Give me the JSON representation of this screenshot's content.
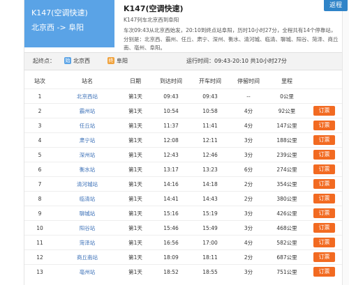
{
  "header": {
    "train_code": "K147(空调快速)",
    "route": "北京西 -> 阜阳",
    "title": "K147(空调快速)",
    "subtitle": "K147列车北京西到阜阳",
    "description": "车次09:43从北京西始发，20:10到终点站阜阳，历时10小时27分，全程共有14个停靠站，分别是：北京西、霸州、任丘、肃宁、深州、衡水、清河城、临清、聊城、阳谷、菏泽、商丘南、亳州、阜阳。",
    "back_label": "返程"
  },
  "info_bar": {
    "label": "起终点：",
    "start": "北京西",
    "start_icon": "始",
    "end": "阜阳",
    "end_icon": "终",
    "run_info": "运行时间：09:43-20:10 共10小时27分"
  },
  "table": {
    "headers": [
      "站次",
      "站名",
      "日期",
      "到达时间",
      "开车时间",
      "停留时间",
      "里程",
      ""
    ],
    "book_label": "订票",
    "rows": [
      {
        "no": "1",
        "station": "北京西站",
        "date": "第1天",
        "arrive": "09:43",
        "depart": "09:43",
        "stop": "--",
        "distance": "0公里",
        "bookable": false
      },
      {
        "no": "2",
        "station": "霸州站",
        "date": "第1天",
        "arrive": "10:54",
        "depart": "10:58",
        "stop": "4分",
        "distance": "92公里",
        "bookable": true
      },
      {
        "no": "3",
        "station": "任丘站",
        "date": "第1天",
        "arrive": "11:37",
        "depart": "11:41",
        "stop": "4分",
        "distance": "147公里",
        "bookable": true
      },
      {
        "no": "4",
        "station": "肃宁站",
        "date": "第1天",
        "arrive": "12:08",
        "depart": "12:11",
        "stop": "3分",
        "distance": "188公里",
        "bookable": true
      },
      {
        "no": "5",
        "station": "深州站",
        "date": "第1天",
        "arrive": "12:43",
        "depart": "12:46",
        "stop": "3分",
        "distance": "239公里",
        "bookable": true
      },
      {
        "no": "6",
        "station": "衡水站",
        "date": "第1天",
        "arrive": "13:17",
        "depart": "13:23",
        "stop": "6分",
        "distance": "274公里",
        "bookable": true
      },
      {
        "no": "7",
        "station": "清河城站",
        "date": "第1天",
        "arrive": "14:16",
        "depart": "14:18",
        "stop": "2分",
        "distance": "354公里",
        "bookable": true
      },
      {
        "no": "8",
        "station": "临清站",
        "date": "第1天",
        "arrive": "14:41",
        "depart": "14:43",
        "stop": "2分",
        "distance": "380公里",
        "bookable": true
      },
      {
        "no": "9",
        "station": "聊城站",
        "date": "第1天",
        "arrive": "15:16",
        "depart": "15:19",
        "stop": "3分",
        "distance": "426公里",
        "bookable": true
      },
      {
        "no": "10",
        "station": "阳谷站",
        "date": "第1天",
        "arrive": "15:46",
        "depart": "15:49",
        "stop": "3分",
        "distance": "468公里",
        "bookable": true
      },
      {
        "no": "11",
        "station": "菏泽站",
        "date": "第1天",
        "arrive": "16:56",
        "depart": "17:00",
        "stop": "4分",
        "distance": "582公里",
        "bookable": true
      },
      {
        "no": "12",
        "station": "商丘南站",
        "date": "第1天",
        "arrive": "18:09",
        "depart": "18:11",
        "stop": "2分",
        "distance": "687公里",
        "bookable": true
      },
      {
        "no": "13",
        "station": "亳州站",
        "date": "第1天",
        "arrive": "18:52",
        "depart": "18:55",
        "stop": "3分",
        "distance": "751公里",
        "bookable": true
      }
    ]
  }
}
